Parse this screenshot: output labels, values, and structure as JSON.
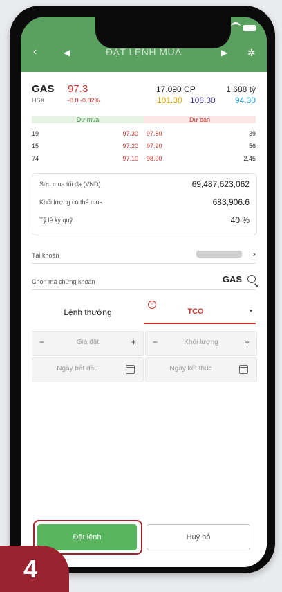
{
  "header": {
    "title": "ĐẶT LỆNH MUA"
  },
  "stock": {
    "symbol": "GAS",
    "exchange": "HSX",
    "price": "97.3",
    "change": "-0.8  -0.82%",
    "volume": "17,090  CP",
    "value": "1.688  tỷ",
    "ceiling": "101.30",
    "reference": "108.30",
    "floor": "94.30"
  },
  "orderbook": {
    "buy_label": "Dư mua",
    "sell_label": "Dư bán",
    "rows": [
      {
        "buy_qty": "19",
        "buy_price": "97.30",
        "sell_price": "97.80",
        "sell_qty": "39"
      },
      {
        "buy_qty": "15",
        "buy_price": "97.20",
        "sell_price": "97.90",
        "sell_qty": "56"
      },
      {
        "buy_qty": "74",
        "buy_price": "97.10",
        "sell_price": "98.00",
        "sell_qty": "2,45"
      }
    ]
  },
  "purchase_info": {
    "max_power_label": "Sức mua tối đa (VND)",
    "max_power_value": "69,487,623,062",
    "buyable_label": "Khối lượng có thể mua",
    "buyable_value": "683,906.6",
    "margin_label": "Tỷ lệ ký quỹ",
    "margin_value": "40 %"
  },
  "account": {
    "label": "Tài khoản"
  },
  "stock_select": {
    "label": "Chọn mã chứng khoán",
    "value": "GAS"
  },
  "order_type": {
    "normal": "Lệnh thường",
    "tco": "TCO"
  },
  "form": {
    "price_placeholder": "Giá đặt",
    "qty_placeholder": "Khối lượng",
    "start_placeholder": "Ngày bắt đầu",
    "end_placeholder": "Ngày kết thúc",
    "minus": "−",
    "plus": "+"
  },
  "actions": {
    "place": "Đặt lệnh",
    "cancel": "Huỷ bỏ"
  },
  "step_badge": "4",
  "colors": {
    "header_green": "#5aa05f",
    "up_red": "#d0342c",
    "ceiling": "#e0a800",
    "ref": "#4b3c92",
    "floor": "#2ba6de",
    "badge": "#9b2330"
  }
}
